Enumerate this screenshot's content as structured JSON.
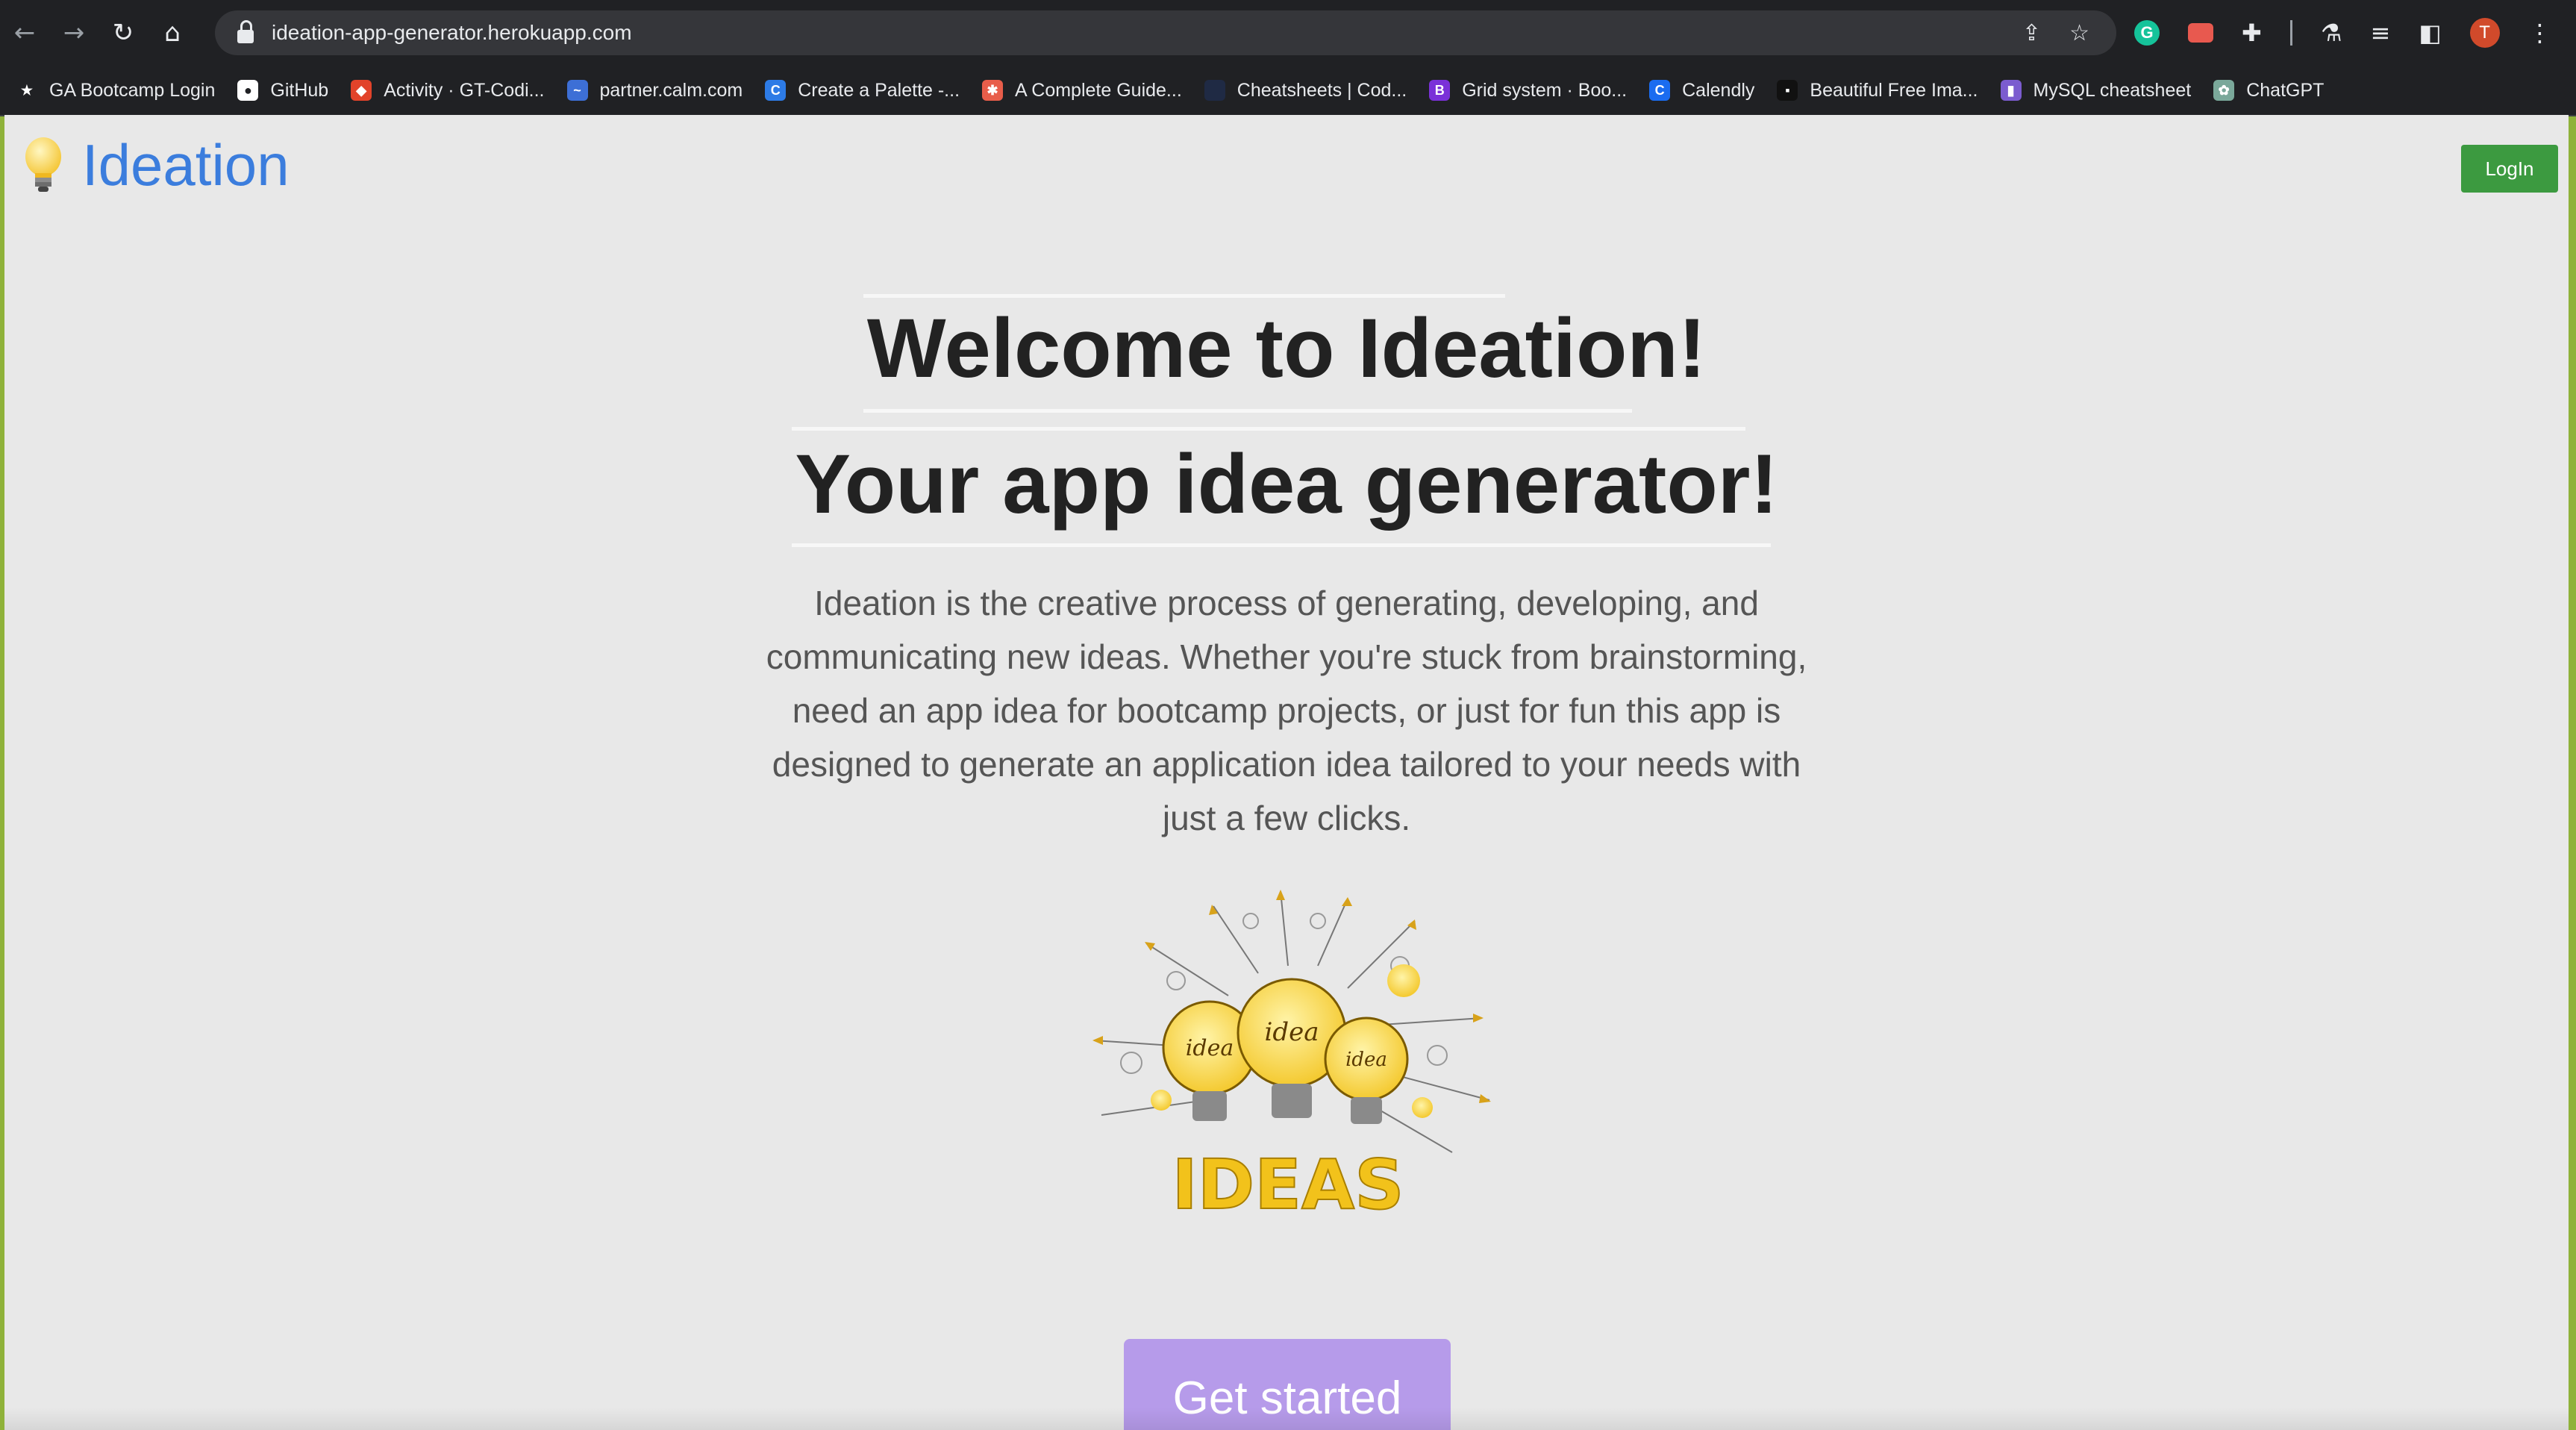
{
  "browser": {
    "url": "ideation-app-generator.herokuapp.com",
    "avatar_initial": "T",
    "grammarly_letter": "G",
    "bookmarks": [
      {
        "label": "GA Bootcamp Login",
        "icon": "ga-icon",
        "color": "#202124",
        "glyph": "★"
      },
      {
        "label": "GitHub",
        "icon": "github-icon",
        "color": "#ffffff",
        "glyph": "●"
      },
      {
        "label": "Activity · GT-Codi...",
        "icon": "gitlab-icon",
        "color": "#e2432a",
        "glyph": "◆"
      },
      {
        "label": "partner.calm.com",
        "icon": "calm-icon",
        "color": "#3d6fd6",
        "glyph": "~"
      },
      {
        "label": "Create a Palette -...",
        "icon": "coolors-icon",
        "color": "#2d7be6",
        "glyph": "C"
      },
      {
        "label": "A Complete Guide...",
        "icon": "css-tricks-icon",
        "color": "#e85d4a",
        "glyph": "✱"
      },
      {
        "label": "Cheatsheets | Cod...",
        "icon": "codecademy-icon",
        "color": "#1f2a44",
        "glyph": " "
      },
      {
        "label": "Grid system · Boo...",
        "icon": "bootstrap-icon",
        "color": "#7a31d8",
        "glyph": "B"
      },
      {
        "label": "Calendly",
        "icon": "calendly-icon",
        "color": "#1a6cf0",
        "glyph": "C"
      },
      {
        "label": "Beautiful Free Ima...",
        "icon": "unsplash-icon",
        "color": "#111111",
        "glyph": "▪"
      },
      {
        "label": "MySQL cheatsheet",
        "icon": "devhints-icon",
        "color": "#7b5ccf",
        "glyph": "▮"
      },
      {
        "label": "ChatGPT",
        "icon": "chatgpt-icon",
        "color": "#7aa89a",
        "glyph": "✿"
      }
    ]
  },
  "header": {
    "brand": "Ideation",
    "login_label": "LogIn"
  },
  "hero": {
    "title_line1": "Welcome to Ideation!",
    "title_line2": "Your app idea generator!",
    "description": "Ideation is the creative process of generating, developing, and communicating new ideas. Whether you're stuck from brainstorming, need an app idea for bootcamp projects, or just for fun this app is designed to generate an application idea tailored to your needs with just a few clicks.",
    "art_text": "IDEAS",
    "bulb_label": "idea",
    "cta_label": "Get started"
  },
  "colors": {
    "brand": "#3b7ddd",
    "login": "#3c9a40",
    "cta": "#b69bea",
    "page_bg": "#e8e8e8"
  }
}
